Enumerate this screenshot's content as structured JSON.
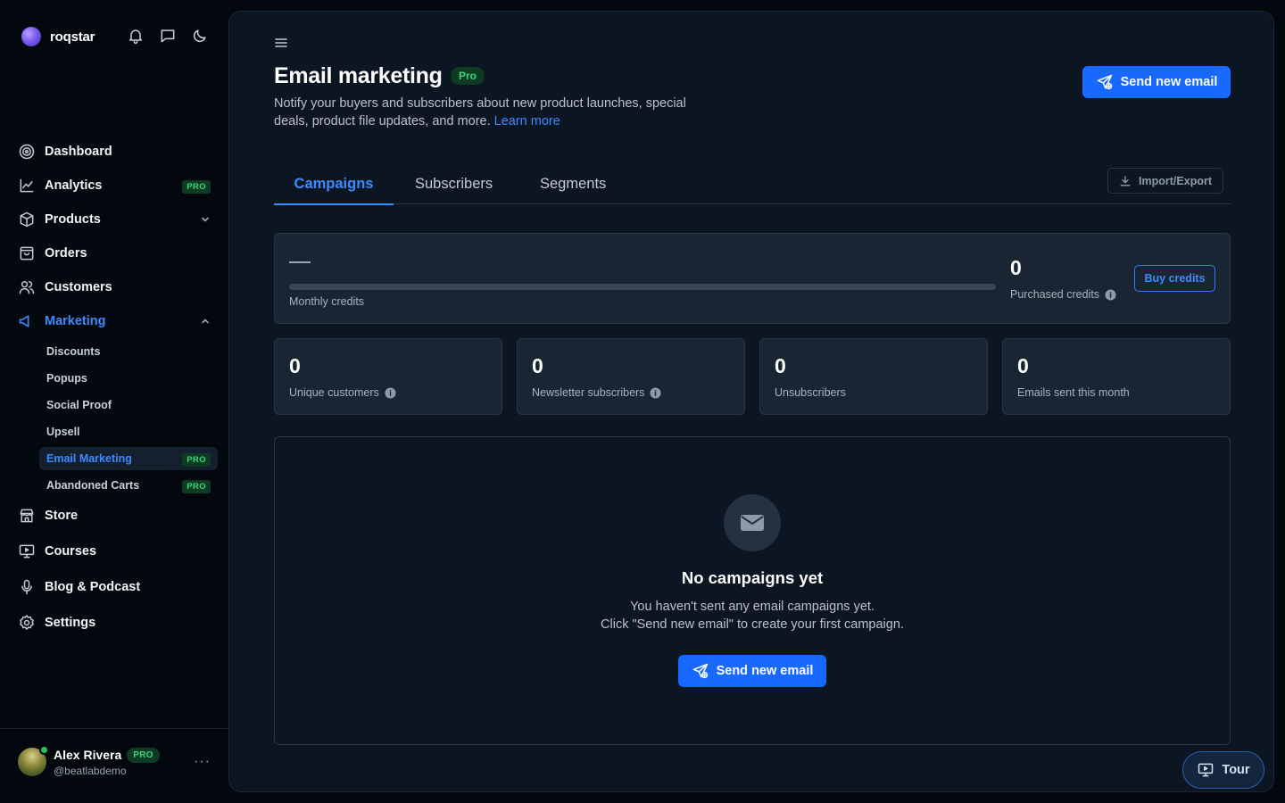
{
  "brand": {
    "name": "roqstar"
  },
  "sidebar": {
    "items": [
      {
        "label": "Dashboard"
      },
      {
        "label": "Analytics",
        "badge": "PRO"
      },
      {
        "label": "Products"
      },
      {
        "label": "Orders"
      },
      {
        "label": "Customers"
      },
      {
        "label": "Marketing"
      },
      {
        "label": "Store"
      },
      {
        "label": "Courses"
      },
      {
        "label": "Blog & Podcast"
      },
      {
        "label": "Settings"
      }
    ],
    "marketing_sub": [
      {
        "label": "Discounts"
      },
      {
        "label": "Popups"
      },
      {
        "label": "Social Proof"
      },
      {
        "label": "Upsell"
      },
      {
        "label": "Email Marketing",
        "badge": "PRO"
      },
      {
        "label": "Abandoned Carts",
        "badge": "PRO"
      }
    ]
  },
  "user": {
    "name": "Alex Rivera",
    "handle": "@beatlabdemo",
    "badge": "PRO",
    "more": "···"
  },
  "header": {
    "title": "Email marketing",
    "badge": "Pro",
    "description": "Notify your buyers and subscribers about new product launches, special deals, product file updates, and more.",
    "learn_more": "Learn more",
    "send_button": "Send new email"
  },
  "tabs": [
    {
      "label": "Campaigns"
    },
    {
      "label": "Subscribers"
    },
    {
      "label": "Segments"
    }
  ],
  "import_export": "Import/Export",
  "credits": {
    "monthly_label": "Monthly credits",
    "purchased_value": "0",
    "purchased_label": "Purchased credits",
    "buy_button": "Buy credits"
  },
  "stats": [
    {
      "value": "0",
      "label": "Unique customers"
    },
    {
      "value": "0",
      "label": "Newsletter subscribers"
    },
    {
      "value": "0",
      "label": "Unsubscribers"
    },
    {
      "value": "0",
      "label": "Emails sent this month"
    }
  ],
  "empty_state": {
    "title": "No campaigns yet",
    "line1": "You haven't sent any email campaigns yet.",
    "line2": "Click \"Send new email\" to create your first campaign.",
    "button": "Send new email"
  },
  "tour": {
    "label": "Tour"
  },
  "colors": {
    "accent": "#1769ff",
    "link": "#3a8bff",
    "pro_green": "#39d67a"
  }
}
